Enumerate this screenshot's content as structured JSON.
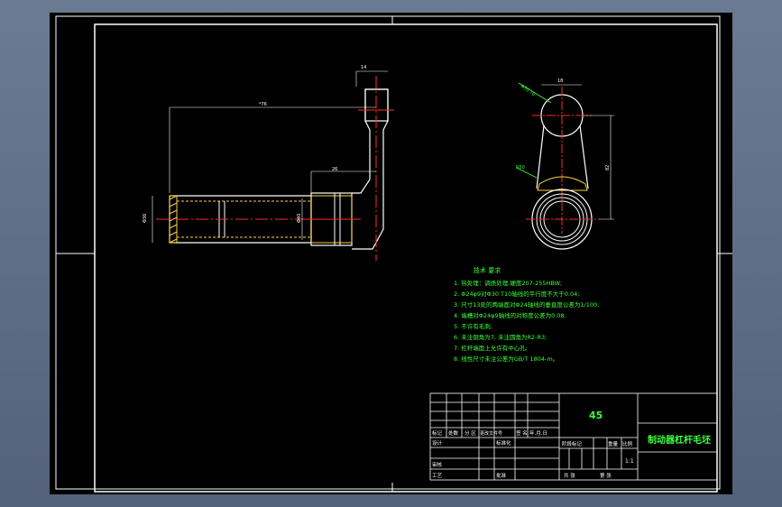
{
  "drawing": {
    "colors": {
      "background": "#000000",
      "frame": "#ffffff",
      "part_outline": "#ffffff",
      "centerline": "#ff2a2a",
      "dimension": "#ffffff",
      "hatch": "#ffd23a",
      "text": "#3cff3c"
    }
  },
  "dimensions": {
    "top_width": "14",
    "long_length": "*76",
    "short_length": "26",
    "left_dia": "Φ36",
    "mid_dia": "Φ40",
    "small_dia": "Φ26",
    "right_small": "18",
    "right_height": "82",
    "right_tilt": "Φ30 T6",
    "right_r": "R50"
  },
  "notes": {
    "title": "技术 要求",
    "items": [
      "1. 热处理：调质处理,硬度207-255HBW;",
      "2. Φ24φ9对Φ30 T10轴线的平行度不大于0.04;",
      "3. 尺寸13处的两端面对Φ24轴线的垂直度公差为1/100;",
      "4. 端槽对Φ24φ9轴线的对称度公差为0.08;",
      "5. 不许有毛刺;",
      "6. 未注倒角为7, 未注圆角为R2-R3;",
      "7. 杠杆端面上允许有中心孔;",
      "8. 线性尺寸未注公差为GB/T 1804-m。"
    ]
  },
  "title_block": {
    "material": "45",
    "part_name": "制动器杠杆毛坯",
    "scale": "1:1",
    "row_labels": {
      "mark": "标记",
      "count": "处数",
      "zone": "分 区",
      "doc_no": "更改文件号",
      "sign": "签 名",
      "date": "年.月.日",
      "design": "设计",
      "std": "标准化",
      "review": "审核",
      "process": "工艺",
      "approve": "批准",
      "stage": "阶段标记",
      "weight": "重量",
      "ratio": "比例",
      "total": "共  张",
      "sheet": "第  张"
    }
  }
}
